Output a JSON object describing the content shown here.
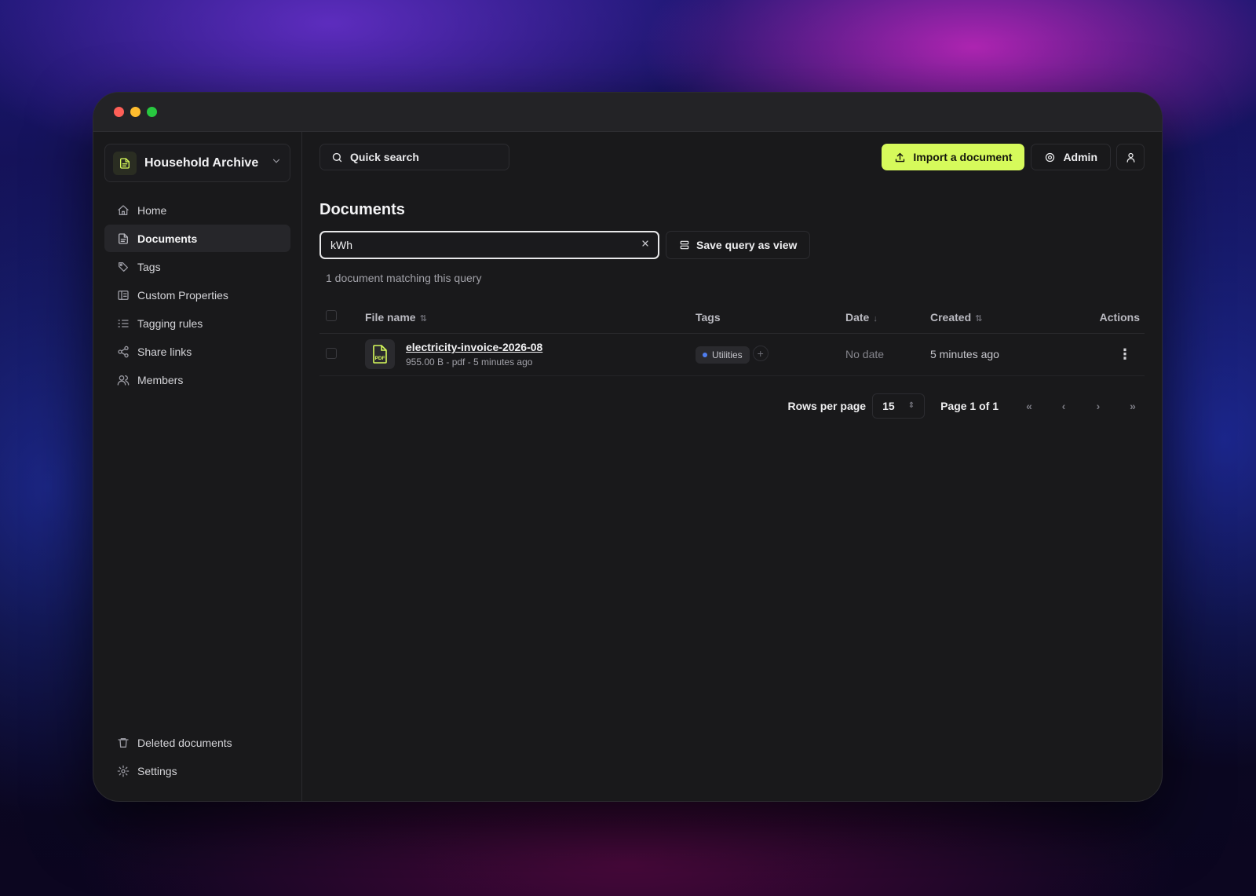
{
  "workspace": {
    "name": "Household Archive",
    "icon": "document-icon"
  },
  "sidebar": {
    "items": [
      {
        "label": "Home",
        "icon": "home-icon"
      },
      {
        "label": "Documents",
        "icon": "document-icon",
        "active": true
      },
      {
        "label": "Tags",
        "icon": "tag-icon"
      },
      {
        "label": "Custom Properties",
        "icon": "properties-icon"
      },
      {
        "label": "Tagging rules",
        "icon": "list-icon"
      },
      {
        "label": "Share links",
        "icon": "share-icon"
      },
      {
        "label": "Members",
        "icon": "users-icon"
      }
    ],
    "bottom_items": [
      {
        "label": "Deleted documents",
        "icon": "trash-icon"
      },
      {
        "label": "Settings",
        "icon": "gear-icon"
      }
    ]
  },
  "topbar": {
    "search_label": "Quick search",
    "import_label": "Import a document",
    "admin_label": "Admin"
  },
  "page": {
    "title": "Documents",
    "query_value": "kWh",
    "save_view_label": "Save query as view",
    "match_count": "1 document matching this query"
  },
  "table": {
    "columns": {
      "file_name": "File name",
      "tags": "Tags",
      "date": "Date",
      "created": "Created",
      "actions": "Actions"
    },
    "rows": [
      {
        "file_name": "electricity-invoice-2026-08",
        "meta": "955.00 B - pdf - 5 minutes ago",
        "file_type_label": "PDF",
        "tag": {
          "label": "Utilities",
          "color": "#4f7ef0"
        },
        "date": "No date",
        "created": "5 minutes ago"
      }
    ]
  },
  "pagination": {
    "rows_per_page_label": "Rows per page",
    "rows_per_page_value": "15",
    "page_label": "Page 1 of 1"
  },
  "colors": {
    "accent": "#d6fa5b",
    "background": "#19191b"
  }
}
